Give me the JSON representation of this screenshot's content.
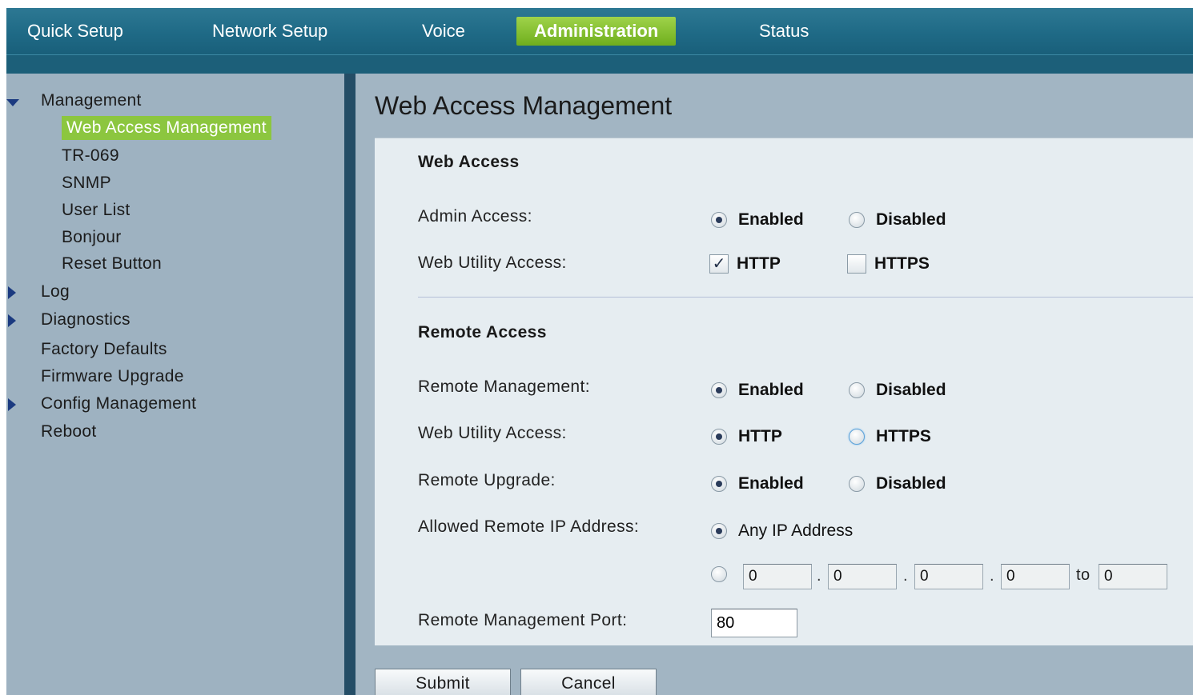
{
  "topnav": {
    "items": [
      "Quick Setup",
      "Network Setup",
      "Voice",
      "Administration",
      "Status"
    ],
    "active": "Administration"
  },
  "sidebar": {
    "management": "Management",
    "sub_items": [
      "Web Access Management",
      "TR-069",
      "SNMP",
      "User List",
      "Bonjour",
      "Reset Button"
    ],
    "log": "Log",
    "diagnostics": "Diagnostics",
    "factory_defaults": "Factory Defaults",
    "firmware_upgrade": "Firmware Upgrade",
    "config_management": "Config Management",
    "reboot": "Reboot"
  },
  "page": {
    "title": "Web Access Management"
  },
  "web_access": {
    "title": "Web Access",
    "admin_access_label": "Admin Access:",
    "admin_enabled": "Enabled",
    "admin_disabled": "Disabled",
    "admin_selected": "Enabled",
    "utility_label": "Web Utility Access:",
    "http": "HTTP",
    "https": "HTTPS",
    "http_checked": true,
    "https_checked": false
  },
  "remote_access": {
    "title": "Remote Access",
    "mgmt_label": "Remote Management:",
    "mgmt_enabled": "Enabled",
    "mgmt_disabled": "Disabled",
    "utility_label": "Web Utility Access:",
    "http": "HTTP",
    "https": "HTTPS",
    "upgrade_label": "Remote Upgrade:",
    "upgrade_enabled": "Enabled",
    "upgrade_disabled": "Disabled",
    "allowed_ip_label": "Allowed Remote IP Address:",
    "any_ip": "Any IP Address",
    "ip_octets": [
      "0",
      "0",
      "0",
      "0"
    ],
    "to_label": "to",
    "to_value": "0",
    "port_label": "Remote Management Port:",
    "port_value": "80"
  },
  "buttons": {
    "submit": "Submit",
    "cancel": "Cancel"
  },
  "colors": {
    "accent": "#8cc63f",
    "nav": "#1f6a86",
    "sidebar": "#9eb2c1",
    "panel": "#e6edf1"
  }
}
